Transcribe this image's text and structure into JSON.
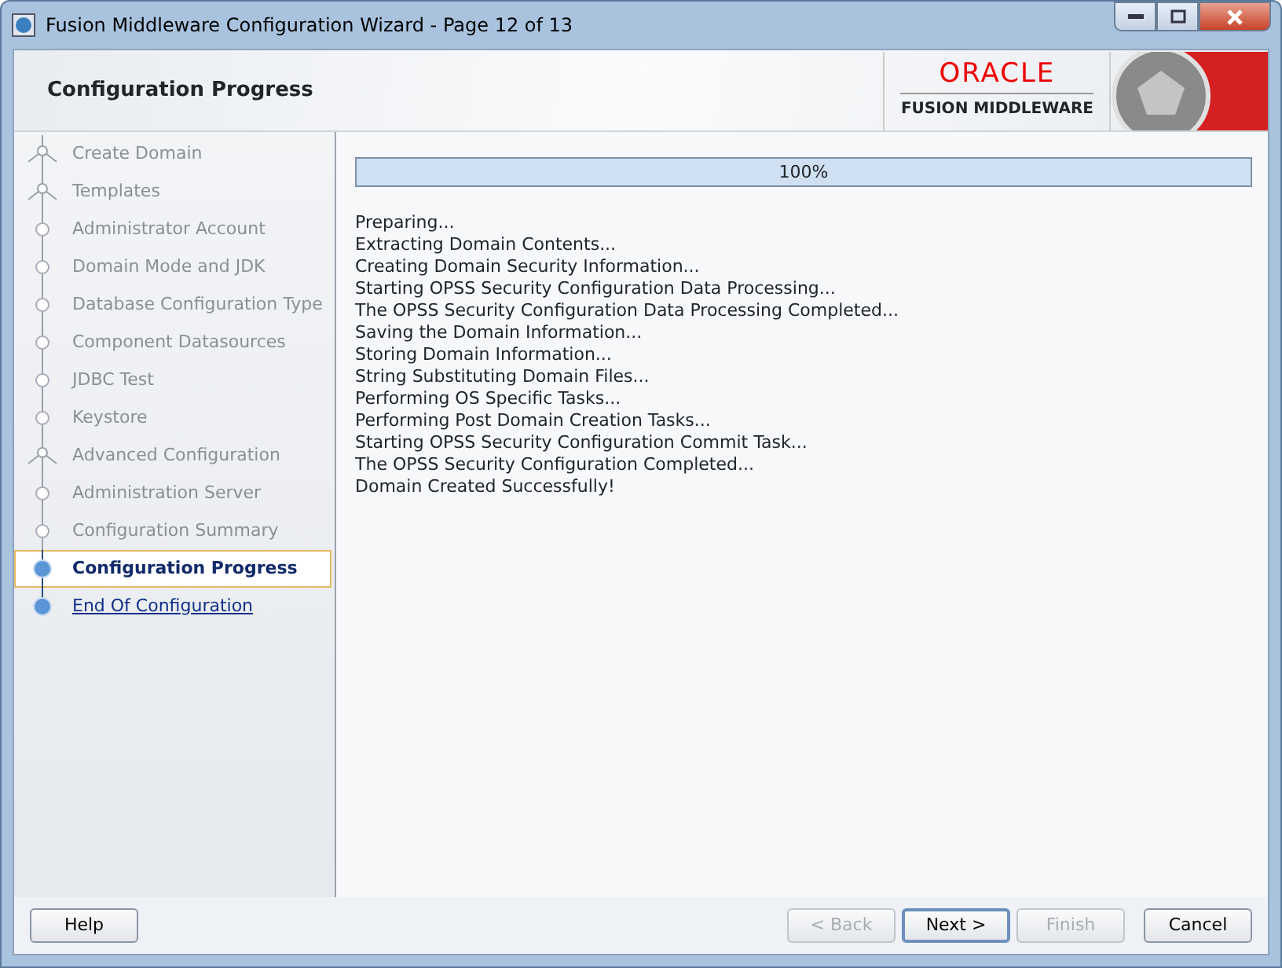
{
  "window": {
    "title": "Fusion Middleware Configuration Wizard - Page 12 of 13"
  },
  "header": {
    "title": "Configuration Progress",
    "brand": "ORACLE",
    "product": "FUSION MIDDLEWARE"
  },
  "steps": [
    {
      "label": "Create Domain",
      "kind": "group",
      "visited": true,
      "selected": false
    },
    {
      "label": "Templates",
      "kind": "group",
      "visited": true,
      "selected": false
    },
    {
      "label": "Administrator Account",
      "kind": "step",
      "visited": true,
      "selected": false
    },
    {
      "label": "Domain Mode and JDK",
      "kind": "step",
      "visited": true,
      "selected": false
    },
    {
      "label": "Database Configuration Type",
      "kind": "step",
      "visited": true,
      "selected": false
    },
    {
      "label": "Component Datasources",
      "kind": "step",
      "visited": true,
      "selected": false
    },
    {
      "label": "JDBC Test",
      "kind": "step",
      "visited": true,
      "selected": false
    },
    {
      "label": "Keystore",
      "kind": "step",
      "visited": true,
      "selected": false
    },
    {
      "label": "Advanced Configuration",
      "kind": "group",
      "visited": true,
      "selected": false
    },
    {
      "label": "Administration Server",
      "kind": "step",
      "visited": true,
      "selected": false
    },
    {
      "label": "Configuration Summary",
      "kind": "step",
      "visited": true,
      "selected": false
    },
    {
      "label": "Configuration Progress",
      "kind": "step",
      "visited": false,
      "selected": true
    },
    {
      "label": "End Of Configuration",
      "kind": "step",
      "visited": false,
      "selected": false
    }
  ],
  "progress": {
    "level": 1,
    "reading": "100%"
  },
  "log": [
    "Preparing...",
    "Extracting Domain Contents...",
    "Creating Domain Security Information...",
    "Starting OPSS Security Configuration Data Processing...",
    "The OPSS Security Configuration Data Processing Completed...",
    "Saving the Domain Information...",
    "Storing Domain Information...",
    "String Substituting Domain Files...",
    "Performing OS Specific Tasks...",
    "Performing Post Domain Creation Tasks...",
    "Starting OPSS Security Configuration Commit Task...",
    "The OPSS Security Configuration Completed...",
    "Domain Created Successfully!"
  ],
  "buttons": {
    "left": [
      {
        "label": "Help",
        "disabled": false,
        "default": false
      }
    ],
    "right": [
      {
        "label": "< Back",
        "disabled": true,
        "default": false
      },
      {
        "label": "Next >",
        "disabled": false,
        "default": true
      },
      {
        "label": "Finish",
        "disabled": true,
        "default": false
      },
      {
        "label": "Cancel",
        "disabled": false,
        "default": false
      }
    ]
  }
}
